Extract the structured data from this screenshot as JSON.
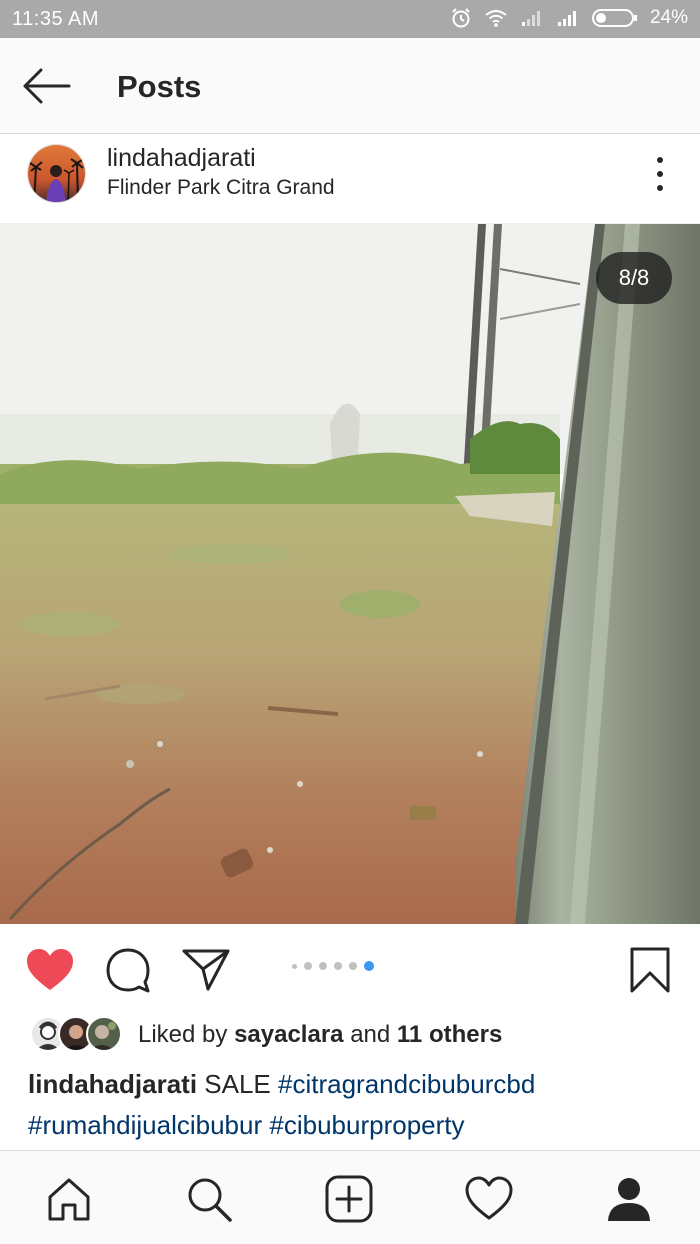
{
  "status_bar": {
    "time": "11:35 AM",
    "battery": "24%",
    "icons": [
      "alarm-icon",
      "wifi-icon",
      "signal-icon",
      "signal-icon",
      "battery-icon"
    ]
  },
  "header": {
    "title": "Posts",
    "back_icon": "arrow-left-icon"
  },
  "post": {
    "username": "lindahadjarati",
    "location": "Flinder Park Citra Grand",
    "counter": "8/8",
    "carousel": {
      "total": 8,
      "current": 8
    },
    "liked": true,
    "likes": {
      "prefix": "Liked by",
      "user": "sayaclara",
      "connector": "and",
      "others": "11 others"
    },
    "caption": {
      "username": "lindahadjarati",
      "text": "SALE",
      "hashtags": [
        "#citragrandcibuburcbd",
        "#rumahdijualcibubur",
        "#cibuburproperty"
      ]
    }
  },
  "colors": {
    "like_red": "#ed4956",
    "hashtag_blue": "#003569",
    "active_dot": "#3897f0",
    "status_bar": "#a9a9a9"
  },
  "bottom_nav": [
    "home-icon",
    "search-icon",
    "add-post-icon",
    "heart-icon",
    "profile-icon"
  ]
}
